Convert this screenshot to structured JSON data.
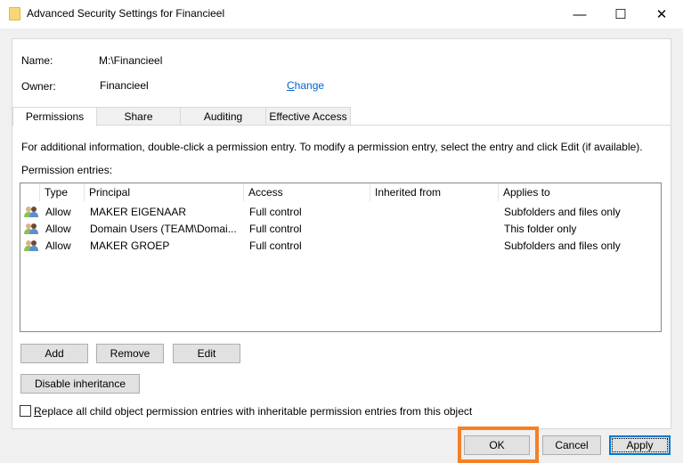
{
  "window": {
    "title": "Advanced Security Settings for Financieel",
    "minimize": "—",
    "maximize": "☐",
    "close": "✕"
  },
  "info": {
    "name_label": "Name:",
    "name_value": "M:\\Financieel",
    "owner_label": "Owner:",
    "owner_value": "Financieel",
    "change_link": "Change"
  },
  "tabs": [
    {
      "label": "Permissions",
      "selected": true
    },
    {
      "label": "Share"
    },
    {
      "label": "Auditing"
    },
    {
      "label": "Effective Access"
    }
  ],
  "permissions": {
    "description": "For additional information, double-click a permission entry. To modify a permission entry, select the entry and click Edit (if available).",
    "entries_label": "Permission entries:",
    "columns": [
      "Type",
      "Principal",
      "Access",
      "Inherited from",
      "Applies to"
    ],
    "rows": [
      {
        "type": "Allow",
        "principal": "MAKER EIGENAAR",
        "access": "Full control",
        "inherited": "",
        "applies": "Subfolders and files only"
      },
      {
        "type": "Allow",
        "principal": "Domain Users (TEAM\\Domai...",
        "access": "Full control",
        "inherited": "",
        "applies": "This folder only"
      },
      {
        "type": "Allow",
        "principal": "MAKER GROEP",
        "access": "Full control",
        "inherited": "",
        "applies": "Subfolders and files only"
      }
    ],
    "add": "Add",
    "remove": "Remove",
    "edit": "Edit",
    "disable_inheritance": "Disable inheritance",
    "replace_checkbox": "Replace all child object permission entries with inheritable permission entries from this object",
    "replace_checked": false
  },
  "footer": {
    "ok": "OK",
    "cancel": "Cancel",
    "apply": "Apply"
  },
  "colors": {
    "highlight": "#f58025",
    "link": "#0066cc",
    "focus": "#0078d7"
  }
}
